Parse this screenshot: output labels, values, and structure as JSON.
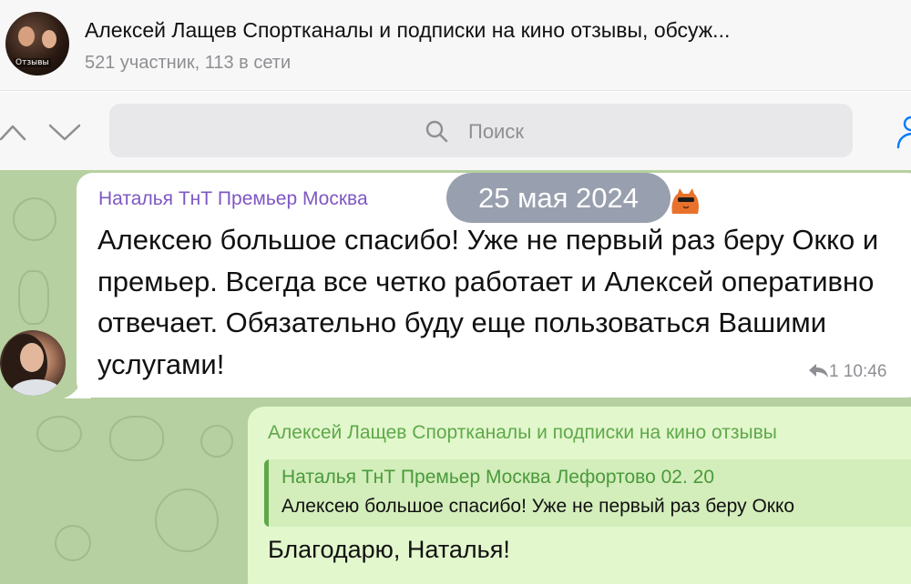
{
  "header": {
    "title": "Алексей Лащев Спортканалы и подписки на кино отзывы, обсуж...",
    "subtitle": "521 участник, 113 в сети",
    "avatar_label": "Отзывы"
  },
  "search": {
    "placeholder": "Поиск"
  },
  "icons": {
    "nav_up": "chevron-up-icon",
    "nav_down": "chevron-down-icon",
    "search": "search-icon",
    "members": "members-icon",
    "reply": "reply-icon",
    "sticker": "cat-sticker-icon"
  },
  "date_pill": "25 мая 2024",
  "messages": {
    "incoming": {
      "sender": "Наталья ТнТ Премьер Москва",
      "text": "Алексею большое спасибо! Уже не первый раз беру Окко и премьер. Всегда все четко работает и Алексей оперативно отвечает. Обязательно буду еще пользоваться Вашими услугами!",
      "reply_count": "1",
      "time": "10:46"
    },
    "outgoing": {
      "sender": "Алексей Лащев Спортканалы и подписки на кино отзывы",
      "quote_sender": "Наталья ТнТ Премьер Москва Лефортово 02. 20",
      "quote_text": "Алексею большое спасибо! Уже не первый раз беру Окко",
      "text": "Благодарю, Наталья!"
    }
  },
  "colors": {
    "accent": "#007aff",
    "incoming_sender": "#7e57c2",
    "outgoing_sender": "#5fa84a",
    "chat_background": "#b7d0a1",
    "outgoing_bubble": "#e2f7cc"
  }
}
